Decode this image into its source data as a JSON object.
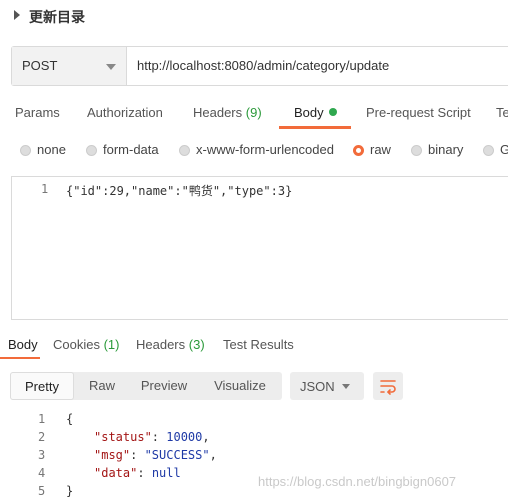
{
  "section": {
    "title": "更新目录"
  },
  "request": {
    "method": "POST",
    "url": "http://localhost:8080/admin/category/update"
  },
  "tabs": [
    {
      "label": "Params"
    },
    {
      "label": "Authorization"
    },
    {
      "label": "Headers",
      "count": "(9)"
    },
    {
      "label": "Body"
    },
    {
      "label": "Pre-request Script"
    },
    {
      "label": "Te"
    }
  ],
  "body_modes": [
    {
      "label": "none",
      "selected": false
    },
    {
      "label": "form-data",
      "selected": false
    },
    {
      "label": "x-www-form-urlencoded",
      "selected": false
    },
    {
      "label": "raw",
      "selected": true
    },
    {
      "label": "binary",
      "selected": false
    },
    {
      "label": "G",
      "selected": false
    }
  ],
  "editor": {
    "line": "1",
    "code": "{\"id\":29,\"name\":\"鸭货\",\"type\":3}"
  },
  "response_tabs": [
    {
      "label": "Body"
    },
    {
      "label": "Cookies",
      "count": "(1)"
    },
    {
      "label": "Headers",
      "count": "(3)"
    },
    {
      "label": "Test Results"
    }
  ],
  "view_modes": [
    "Pretty",
    "Raw",
    "Preview",
    "Visualize"
  ],
  "format": "JSON",
  "response_lines": [
    {
      "n": "1",
      "text": "{"
    },
    {
      "n": "2",
      "key": "\"status\"",
      "sep": ": ",
      "val": "10000",
      "tail": ","
    },
    {
      "n": "3",
      "key": "\"msg\"",
      "sep": ": ",
      "val": "\"SUCCESS\"",
      "tail": ","
    },
    {
      "n": "4",
      "key": "\"data\"",
      "sep": ": ",
      "val": "null",
      "tail": ""
    },
    {
      "n": "5",
      "text": "}"
    }
  ],
  "watermark": "https://blog.csdn.net/bingbign0607",
  "colors": {
    "accent": "#f26b3a",
    "count_green": "#2b9a3a"
  }
}
